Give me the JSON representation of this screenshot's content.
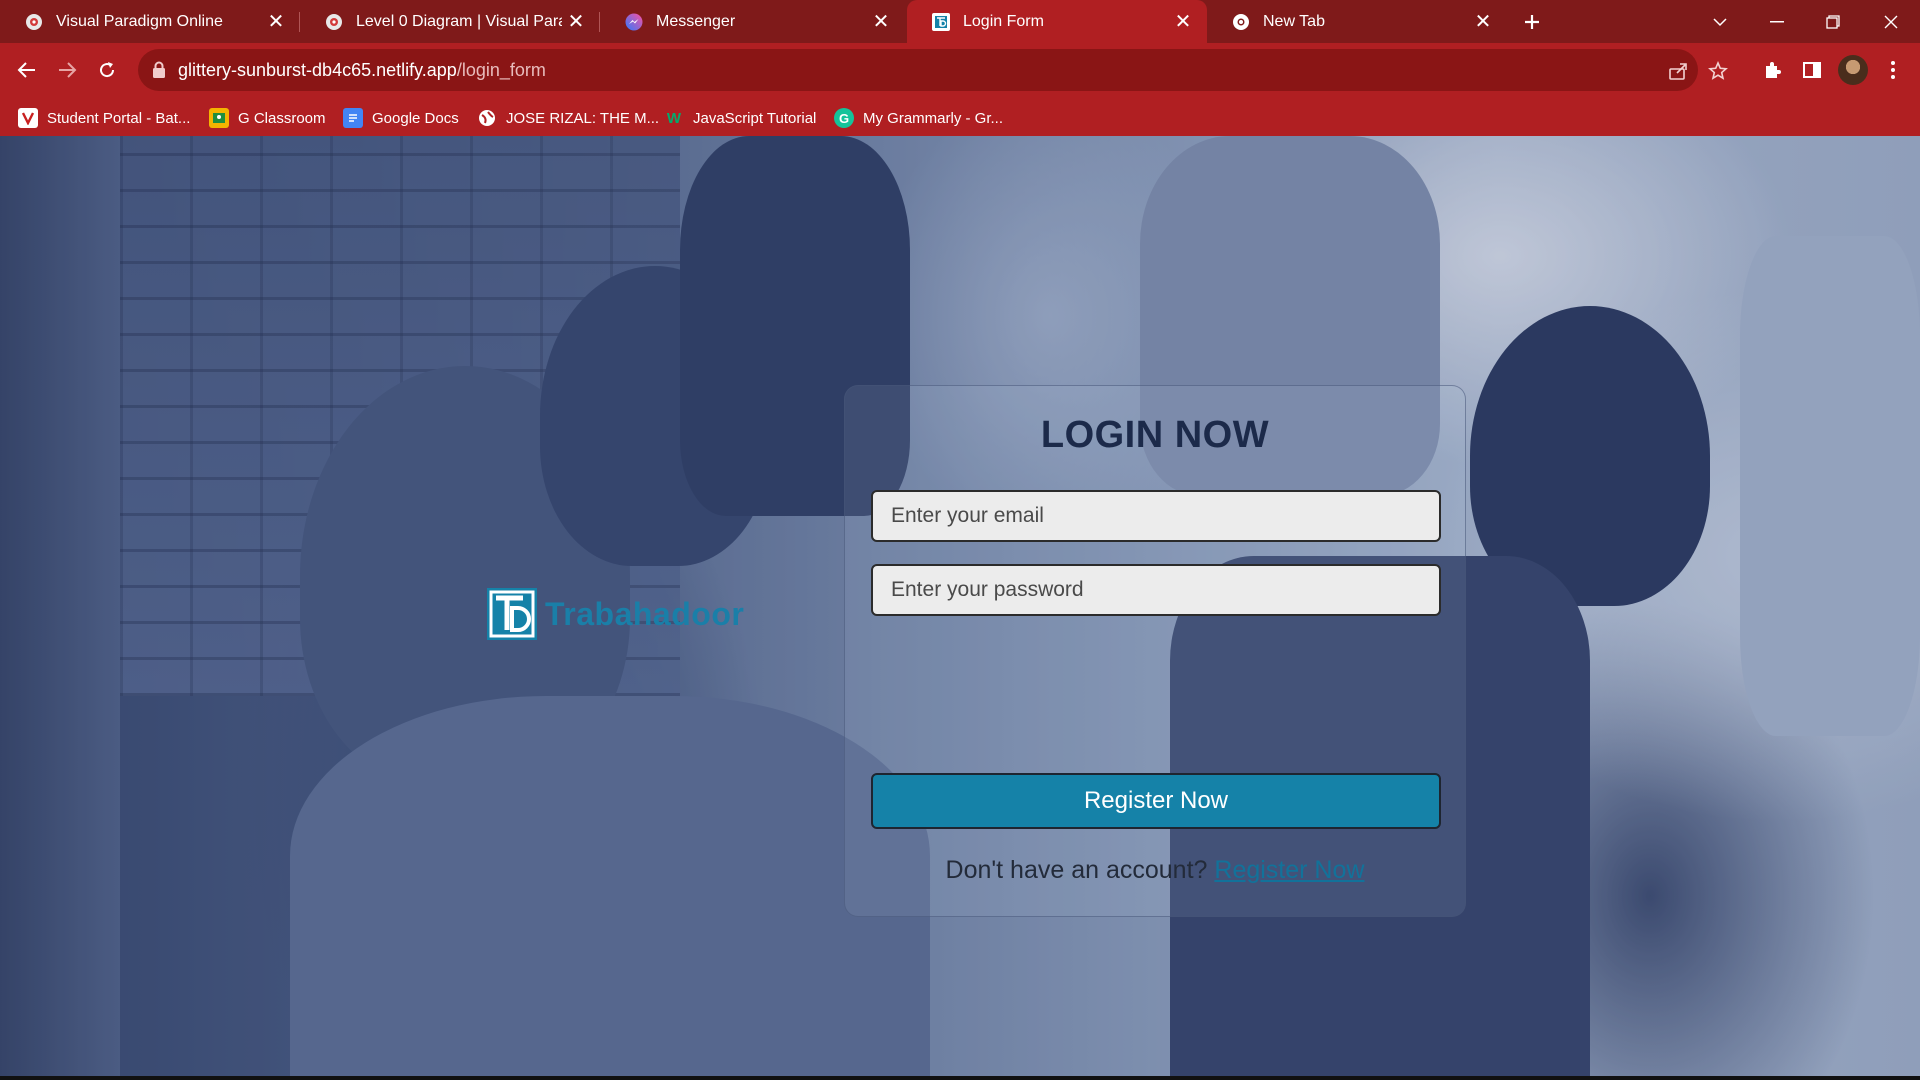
{
  "tabs": [
    {
      "title": "Visual Paradigm Online",
      "icon": "visual-paradigm-icon",
      "active": false
    },
    {
      "title": "Level 0 Diagram | Visual Paradigm",
      "icon": "visual-paradigm-icon",
      "active": false
    },
    {
      "title": "Messenger",
      "icon": "messenger-icon",
      "active": false
    },
    {
      "title": "Login Form",
      "icon": "trabahadoor-icon",
      "active": true
    },
    {
      "title": "New Tab",
      "icon": "chrome-icon",
      "active": false
    }
  ],
  "address_bar": {
    "domain": "glittery-sunburst-db4c65.netlify.app",
    "path": "/login_form"
  },
  "bookmarks": [
    {
      "label": "Student Portal - Bat...",
      "icon": "student-portal-icon"
    },
    {
      "label": "G Classroom",
      "icon": "classroom-icon"
    },
    {
      "label": "Google Docs",
      "icon": "docs-icon"
    },
    {
      "label": "JOSE RIZAL: THE M...",
      "icon": "globe-icon"
    },
    {
      "label": "JavaScript Tutorial",
      "icon": "w3schools-icon"
    },
    {
      "label": "My Grammarly - Gr...",
      "icon": "grammarly-icon"
    }
  ],
  "brand": {
    "name": "Trabahadoor"
  },
  "login": {
    "title": "LOGIN NOW",
    "email_placeholder": "Enter your email",
    "password_placeholder": "Enter your password",
    "submit_label": "Register Now",
    "footer_text": "Don't have an account?",
    "footer_link": "Register Now"
  },
  "colors": {
    "tabbar": "#7f1a1a",
    "toolbar": "#b01f22",
    "button": "#1582a8",
    "brand": "#1a7fa8"
  }
}
